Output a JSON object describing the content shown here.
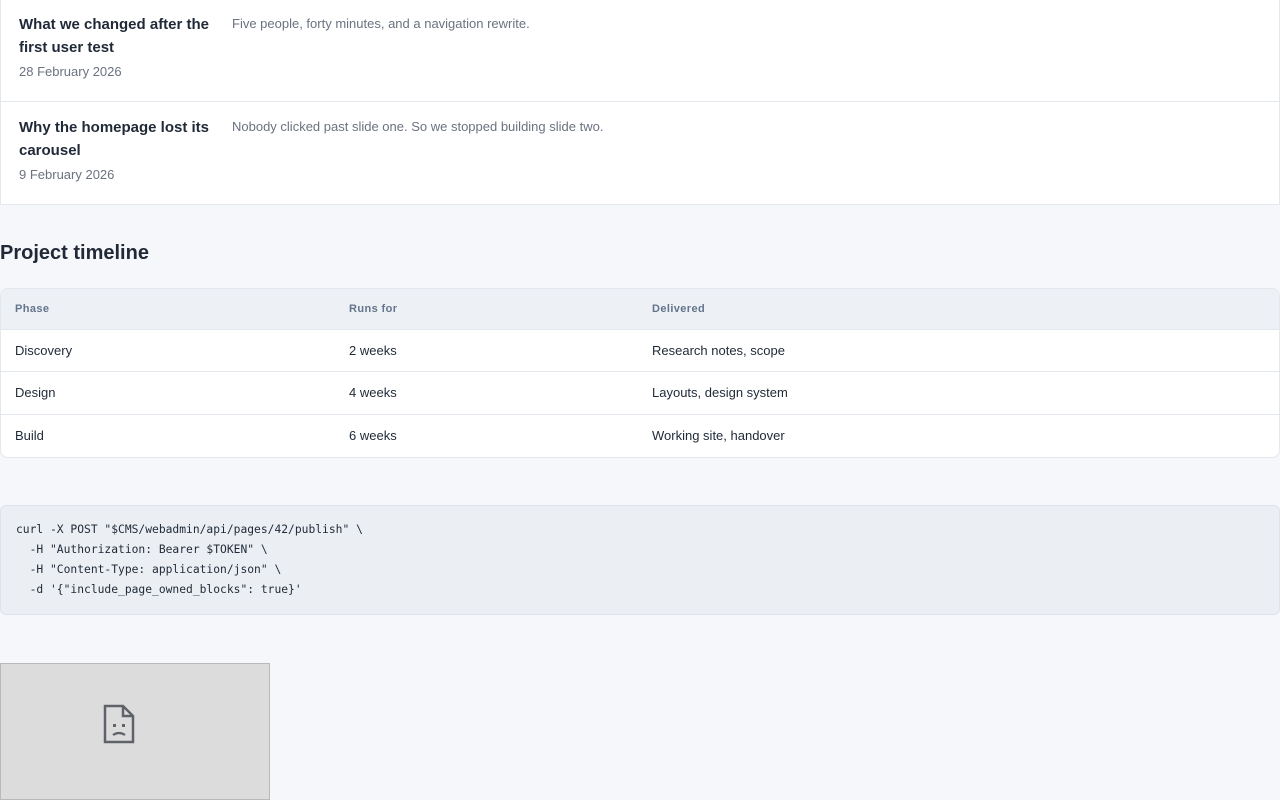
{
  "posts": [
    {
      "title": "What we changed after the first user test",
      "date": "28 February 2026",
      "excerpt": "Five people, forty minutes, and a navigation rewrite."
    },
    {
      "title": "Why the homepage lost its carousel",
      "date": "9 February 2026",
      "excerpt": "Nobody clicked past slide one. So we stopped building slide two."
    }
  ],
  "timeline": {
    "title": "Project timeline",
    "headers": [
      "Phase",
      "Runs for",
      "Delivered"
    ],
    "rows": [
      [
        "Discovery",
        "2 weeks",
        "Research notes, scope"
      ],
      [
        "Design",
        "4 weeks",
        "Layouts, design system"
      ],
      [
        "Build",
        "6 weeks",
        "Working site, handover"
      ]
    ]
  },
  "code": {
    "lines": [
      "curl -X POST \"$CMS/webadmin/api/pages/42/publish\" \\",
      "  -H \"Authorization: Bearer $TOKEN\" \\",
      "  -H \"Content-Type: application/json\" \\",
      "  -d '{\"include_page_owned_blocks\": true}'"
    ]
  },
  "image": {
    "icon": "broken-image-icon"
  }
}
